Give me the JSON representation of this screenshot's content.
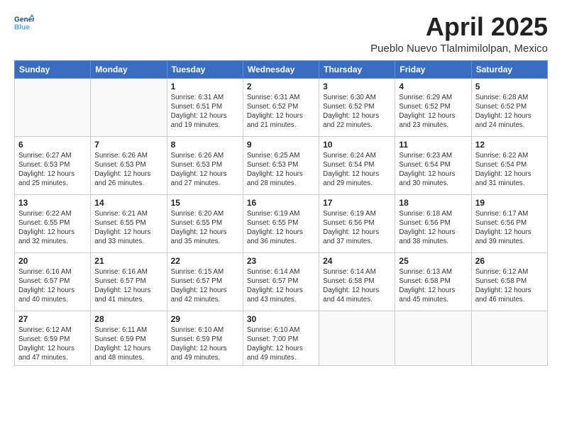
{
  "header": {
    "logo_line1": "General",
    "logo_line2": "Blue",
    "month_title": "April 2025",
    "subtitle": "Pueblo Nuevo Tlalmimilolpan, Mexico"
  },
  "weekdays": [
    "Sunday",
    "Monday",
    "Tuesday",
    "Wednesday",
    "Thursday",
    "Friday",
    "Saturday"
  ],
  "weeks": [
    [
      {
        "day": "",
        "info": ""
      },
      {
        "day": "",
        "info": ""
      },
      {
        "day": "1",
        "info": "Sunrise: 6:31 AM\nSunset: 6:51 PM\nDaylight: 12 hours and 19 minutes."
      },
      {
        "day": "2",
        "info": "Sunrise: 6:31 AM\nSunset: 6:52 PM\nDaylight: 12 hours and 21 minutes."
      },
      {
        "day": "3",
        "info": "Sunrise: 6:30 AM\nSunset: 6:52 PM\nDaylight: 12 hours and 22 minutes."
      },
      {
        "day": "4",
        "info": "Sunrise: 6:29 AM\nSunset: 6:52 PM\nDaylight: 12 hours and 23 minutes."
      },
      {
        "day": "5",
        "info": "Sunrise: 6:28 AM\nSunset: 6:52 PM\nDaylight: 12 hours and 24 minutes."
      }
    ],
    [
      {
        "day": "6",
        "info": "Sunrise: 6:27 AM\nSunset: 6:53 PM\nDaylight: 12 hours and 25 minutes."
      },
      {
        "day": "7",
        "info": "Sunrise: 6:26 AM\nSunset: 6:53 PM\nDaylight: 12 hours and 26 minutes."
      },
      {
        "day": "8",
        "info": "Sunrise: 6:26 AM\nSunset: 6:53 PM\nDaylight: 12 hours and 27 minutes."
      },
      {
        "day": "9",
        "info": "Sunrise: 6:25 AM\nSunset: 6:53 PM\nDaylight: 12 hours and 28 minutes."
      },
      {
        "day": "10",
        "info": "Sunrise: 6:24 AM\nSunset: 6:54 PM\nDaylight: 12 hours and 29 minutes."
      },
      {
        "day": "11",
        "info": "Sunrise: 6:23 AM\nSunset: 6:54 PM\nDaylight: 12 hours and 30 minutes."
      },
      {
        "day": "12",
        "info": "Sunrise: 6:22 AM\nSunset: 6:54 PM\nDaylight: 12 hours and 31 minutes."
      }
    ],
    [
      {
        "day": "13",
        "info": "Sunrise: 6:22 AM\nSunset: 6:55 PM\nDaylight: 12 hours and 32 minutes."
      },
      {
        "day": "14",
        "info": "Sunrise: 6:21 AM\nSunset: 6:55 PM\nDaylight: 12 hours and 33 minutes."
      },
      {
        "day": "15",
        "info": "Sunrise: 6:20 AM\nSunset: 6:55 PM\nDaylight: 12 hours and 35 minutes."
      },
      {
        "day": "16",
        "info": "Sunrise: 6:19 AM\nSunset: 6:55 PM\nDaylight: 12 hours and 36 minutes."
      },
      {
        "day": "17",
        "info": "Sunrise: 6:19 AM\nSunset: 6:56 PM\nDaylight: 12 hours and 37 minutes."
      },
      {
        "day": "18",
        "info": "Sunrise: 6:18 AM\nSunset: 6:56 PM\nDaylight: 12 hours and 38 minutes."
      },
      {
        "day": "19",
        "info": "Sunrise: 6:17 AM\nSunset: 6:56 PM\nDaylight: 12 hours and 39 minutes."
      }
    ],
    [
      {
        "day": "20",
        "info": "Sunrise: 6:16 AM\nSunset: 6:57 PM\nDaylight: 12 hours and 40 minutes."
      },
      {
        "day": "21",
        "info": "Sunrise: 6:16 AM\nSunset: 6:57 PM\nDaylight: 12 hours and 41 minutes."
      },
      {
        "day": "22",
        "info": "Sunrise: 6:15 AM\nSunset: 6:57 PM\nDaylight: 12 hours and 42 minutes."
      },
      {
        "day": "23",
        "info": "Sunrise: 6:14 AM\nSunset: 6:57 PM\nDaylight: 12 hours and 43 minutes."
      },
      {
        "day": "24",
        "info": "Sunrise: 6:14 AM\nSunset: 6:58 PM\nDaylight: 12 hours and 44 minutes."
      },
      {
        "day": "25",
        "info": "Sunrise: 6:13 AM\nSunset: 6:58 PM\nDaylight: 12 hours and 45 minutes."
      },
      {
        "day": "26",
        "info": "Sunrise: 6:12 AM\nSunset: 6:58 PM\nDaylight: 12 hours and 46 minutes."
      }
    ],
    [
      {
        "day": "27",
        "info": "Sunrise: 6:12 AM\nSunset: 6:59 PM\nDaylight: 12 hours and 47 minutes."
      },
      {
        "day": "28",
        "info": "Sunrise: 6:11 AM\nSunset: 6:59 PM\nDaylight: 12 hours and 48 minutes."
      },
      {
        "day": "29",
        "info": "Sunrise: 6:10 AM\nSunset: 6:59 PM\nDaylight: 12 hours and 49 minutes."
      },
      {
        "day": "30",
        "info": "Sunrise: 6:10 AM\nSunset: 7:00 PM\nDaylight: 12 hours and 49 minutes."
      },
      {
        "day": "",
        "info": ""
      },
      {
        "day": "",
        "info": ""
      },
      {
        "day": "",
        "info": ""
      }
    ]
  ]
}
